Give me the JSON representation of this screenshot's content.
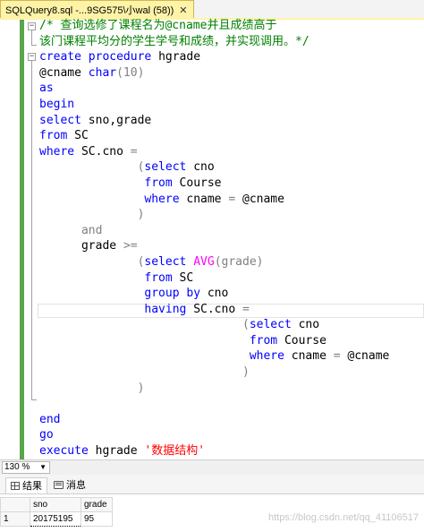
{
  "tab": {
    "title": "SQLQuery8.sql -...9SG575\\小wal (58))",
    "close_glyph": "✕"
  },
  "code": {
    "comment_line1": "/* 查询选修了课程名为@cname并且成绩高于",
    "comment_line2": "该门课程平均分的学生学号和成绩，并实现调用。*/",
    "kw_create": "create",
    "kw_procedure": "procedure",
    "proc_name": "hgrade",
    "param": "@cname",
    "type_char": "char",
    "type_len": "(10)",
    "kw_as": "as",
    "kw_begin": "begin",
    "kw_select": "select",
    "select_cols": "sno,grade",
    "kw_from": "from",
    "table_sc": "SC",
    "kw_where": "where",
    "sc_cno": "SC.cno",
    "op_eq": "=",
    "open_paren": "(",
    "close_paren": ")",
    "col_cno": "cno",
    "table_course": "Course",
    "col_cname": "cname",
    "kw_and": "and",
    "col_grade": "grade",
    "op_gte": ">=",
    "fn_avg": "AVG",
    "avg_arg": "(grade)",
    "kw_group": "group",
    "kw_by": "by",
    "kw_having": "having",
    "kw_end": "end",
    "kw_go": "go",
    "kw_execute": "execute",
    "exec_arg": "'数据结构'"
  },
  "status": {
    "zoom": "130 %",
    "zoom_arrow": "▼"
  },
  "results": {
    "tabs": [
      {
        "label": "结果",
        "icon": "grid-icon"
      },
      {
        "label": "消息",
        "icon": "message-icon"
      }
    ],
    "columns": [
      "sno",
      "grade"
    ],
    "rows": [
      {
        "num": "1",
        "sno": "20175195",
        "grade": "95"
      }
    ],
    "watermark": "https://blog.csdn.net/qq_41106517"
  }
}
